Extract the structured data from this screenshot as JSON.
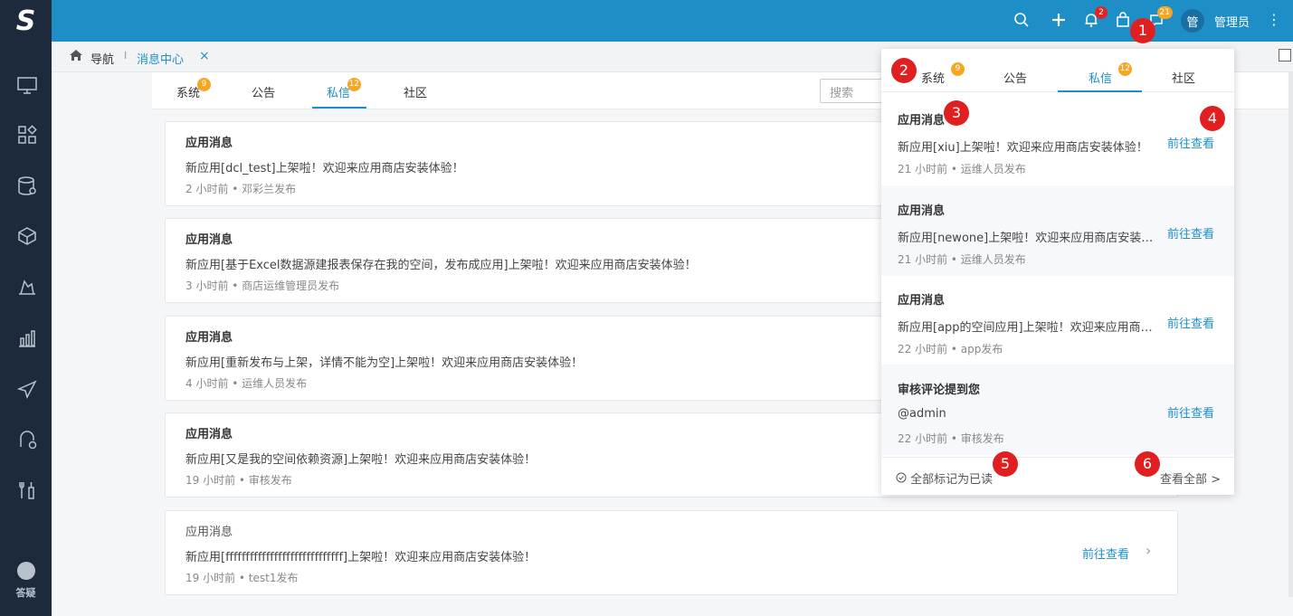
{
  "app": {
    "logo_text": "S",
    "accent": "#1e8fc6",
    "sidebar_bg": "#1c2a3b"
  },
  "topbar": {
    "bell_badge": "2",
    "messages_badge": "21",
    "avatar_text": "管",
    "username": "管理员"
  },
  "sidebar": {
    "icons": [
      "monitor-icon",
      "apps-icon",
      "database-icon",
      "package-icon",
      "design-icon",
      "chart-icon",
      "send-icon",
      "workflow-icon",
      "tools-icon"
    ],
    "help_label": "答疑"
  },
  "breadcrumb": {
    "nav_label": "导航",
    "separator": "I",
    "tab_label": "消息中心",
    "close_glyph": "×"
  },
  "main_tabs": [
    {
      "label": "系统",
      "badge": "9"
    },
    {
      "label": "公告",
      "badge": ""
    },
    {
      "label": "私信",
      "badge": "12"
    },
    {
      "label": "社区",
      "badge": ""
    }
  ],
  "search_placeholder": "搜索",
  "messages": [
    {
      "title": "应用消息",
      "body": "新应用[dcl_test]上架啦！欢迎来应用商店安装体验！",
      "meta": "2 小时前 • 邓彩兰发布"
    },
    {
      "title": "应用消息",
      "body": "新应用[基于Excel数据源建报表保存在我的空间，发布成应用]上架啦！欢迎来应用商店安装体验！",
      "meta": "3 小时前 • 商店运维管理员发布"
    },
    {
      "title": "应用消息",
      "body": "新应用[重新发布与上架，详情不能为空]上架啦！欢迎来应用商店安装体验！",
      "meta": "4 小时前 • 运维人员发布"
    },
    {
      "title": "应用消息",
      "body": "新应用[又是我的空间依赖资源]上架啦！欢迎来应用商店安装体验！",
      "meta": "19 小时前 • 审核发布"
    },
    {
      "title": "应用消息",
      "body": "新应用[fffffffffffffffffffffffffffff]上架啦！欢迎来应用商店安装体验！",
      "meta": "19 小时前 • test1发布",
      "link": "前往查看"
    }
  ],
  "popup": {
    "tabs": [
      {
        "label": "系统",
        "badge": "9"
      },
      {
        "label": "公告",
        "badge": ""
      },
      {
        "label": "私信",
        "badge": "12"
      },
      {
        "label": "社区",
        "badge": ""
      }
    ],
    "items": [
      {
        "title": "应用消息",
        "body": "新应用[xiu]上架啦！欢迎来应用商店安装体验！",
        "meta": "21 小时前 • 运维人员发布",
        "link": "前往查看"
      },
      {
        "title": "应用消息",
        "body": "新应用[newone]上架啦！欢迎来应用商店安装体验！",
        "meta": "21 小时前 • 运维人员发布",
        "link": "前往查看"
      },
      {
        "title": "应用消息",
        "body": "新应用[app的空间应用]上架啦！欢迎来应用商店安装体验！",
        "meta": "22 小时前 • app发布",
        "link": "前往查看"
      },
      {
        "title": "审核评论提到您",
        "body": "@admin",
        "meta": "22 小时前 • 审核发布",
        "link": "前往查看"
      }
    ],
    "mark_all": "全部标记为已读",
    "view_all": "查看全部 >"
  },
  "markers": [
    "1",
    "2",
    "3",
    "4",
    "5",
    "6"
  ]
}
